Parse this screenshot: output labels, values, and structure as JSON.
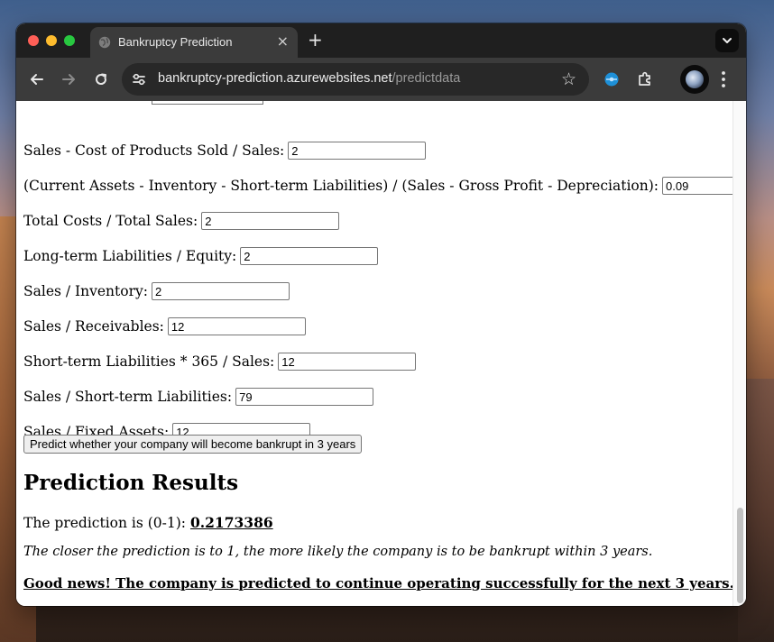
{
  "browser": {
    "tab_title": "Bankruptcy Prediction",
    "tab_close": "×",
    "new_tab": "+",
    "url_host": "bankruptcy-prediction.azurewebsites.net",
    "url_path": "/predictdata"
  },
  "form": {
    "fields": [
      {
        "label": "Sales - Cost of Products Sold / Sales:",
        "value": "2"
      },
      {
        "label": "(Current Assets - Inventory - Short-term Liabilities) / (Sales - Gross Profit - Depreciation):",
        "value": "0.09"
      },
      {
        "label": "Total Costs / Total Sales:",
        "value": "2"
      },
      {
        "label": "Long-term Liabilities / Equity:",
        "value": "2"
      },
      {
        "label": "Sales / Inventory:",
        "value": "2"
      },
      {
        "label": "Sales / Receivables:",
        "value": "12"
      },
      {
        "label": "Short-term Liabilities * 365 / Sales:",
        "value": "12"
      },
      {
        "label": "Sales / Short-term Liabilities:",
        "value": "79"
      },
      {
        "label": "Sales / Fixed Assets:",
        "value": "12"
      }
    ],
    "submit_label": "Predict whether your company will become bankrupt in 3 years"
  },
  "results": {
    "heading": "Prediction Results",
    "prediction_label": "The prediction is (0-1):",
    "prediction_value": "0.2173386",
    "note": "The closer the prediction is to 1, the more likely the company is to be bankrupt within 3 years.",
    "verdict": "Good news! The company is predicted to continue operating successfully for the next 3 years."
  }
}
